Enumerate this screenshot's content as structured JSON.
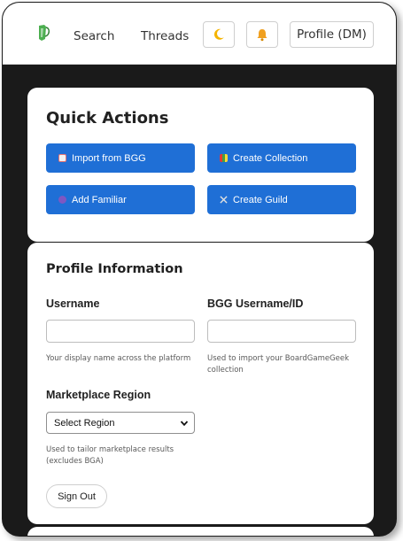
{
  "header": {
    "nav": {
      "search": "Search",
      "threads": "Threads"
    },
    "theme_icon": "crescent-moon-icon",
    "notification_icon": "bell-icon",
    "profile_label": "Profile (DM)"
  },
  "quick_actions": {
    "title": "Quick Actions",
    "buttons": [
      {
        "label": "Import from BGG",
        "icon": "import-icon"
      },
      {
        "label": "Create Collection",
        "icon": "collection-icon"
      },
      {
        "label": "Add Familiar",
        "icon": "familiar-icon"
      },
      {
        "label": "Create Guild",
        "icon": "guild-icon"
      }
    ],
    "accent_color": "#1f6fd6"
  },
  "profile": {
    "title": "Profile Information",
    "username": {
      "label": "Username",
      "value": "",
      "help": "Your display name across the platform"
    },
    "bgg": {
      "label": "BGG Username/ID",
      "value": "",
      "help": "Used to import your BoardGameGeek collection"
    },
    "region": {
      "label": "Marketplace Region",
      "selected": "Select Region",
      "help": "Used to tailor marketplace results (excludes BGA)"
    },
    "sign_out": "Sign Out"
  }
}
